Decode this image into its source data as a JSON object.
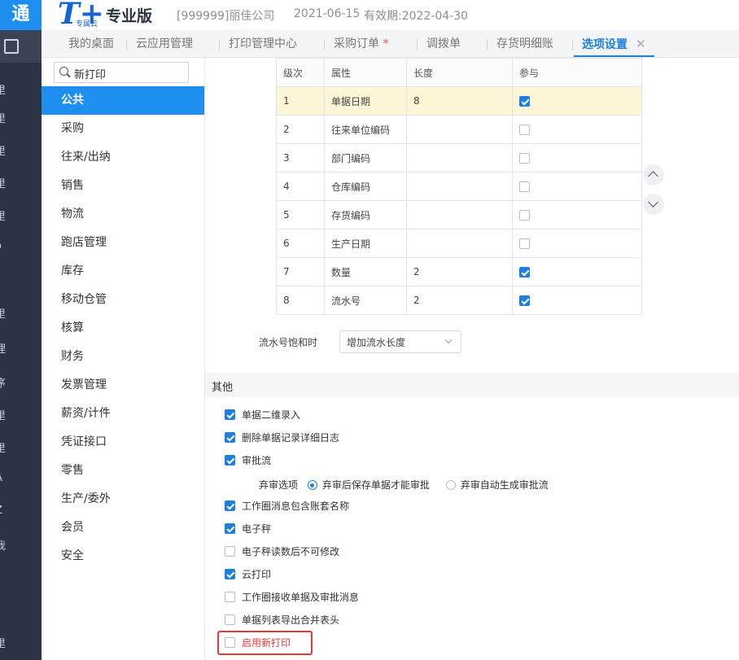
{
  "app": {
    "rail_title": "通",
    "logo_sub": "专属云",
    "edition": "专业版",
    "company": "[999999]丽佳公司",
    "date": "2021-06-15",
    "expire": "有效期:2022-04-30"
  },
  "rail_chars": [
    "里",
    "里",
    "里",
    "里",
    "里",
    "o",
    "里",
    "理",
    "序",
    "里",
    "里",
    "A",
    "Z",
    "我",
    "里"
  ],
  "tabs": [
    {
      "label": "我的桌面"
    },
    {
      "label": "云应用管理"
    },
    {
      "label": "打印管理中心"
    },
    {
      "label": "采购订单",
      "star": "*"
    },
    {
      "label": "调拨单"
    },
    {
      "label": "存货明细账"
    },
    {
      "label": "选项设置",
      "close": "✕"
    }
  ],
  "sidebar": {
    "search_value": "新打印",
    "items": [
      "公共",
      "采购",
      "往来/出纳",
      "销售",
      "物流",
      "跑店管理",
      "库存",
      "移动仓管",
      "核算",
      "财务",
      "发票管理",
      "薪资/计件",
      "凭证接口",
      "零售",
      "生产/委外",
      "会员",
      "安全"
    ]
  },
  "grid": {
    "headers": [
      "级次",
      "属性",
      "长度",
      "参与"
    ],
    "rows": [
      {
        "level": "1",
        "attr": "单据日期",
        "length": "8",
        "checked": true
      },
      {
        "level": "2",
        "attr": "往来单位编码",
        "length": "",
        "checked": false
      },
      {
        "level": "3",
        "attr": "部门编码",
        "length": "",
        "checked": false
      },
      {
        "level": "4",
        "attr": "仓库编码",
        "length": "",
        "checked": false
      },
      {
        "level": "5",
        "attr": "存货编码",
        "length": "",
        "checked": false
      },
      {
        "level": "6",
        "attr": "生产日期",
        "length": "",
        "checked": false
      },
      {
        "level": "7",
        "attr": "数量",
        "length": "2",
        "checked": true
      },
      {
        "level": "8",
        "attr": "流水号",
        "length": "2",
        "checked": true
      }
    ]
  },
  "serial": {
    "label": "流水号饱和时",
    "value": "增加流水长度"
  },
  "other": {
    "title": "其他",
    "options": [
      {
        "label": "单据二维录入",
        "checked": true
      },
      {
        "label": "删除单据记录详细日志",
        "checked": true
      },
      {
        "label": "审批流",
        "checked": true
      },
      {
        "label": "工作圈消息包含账套名称",
        "checked": true
      },
      {
        "label": "电子秤",
        "checked": true
      },
      {
        "label": "电子秤读数后不可修改",
        "checked": false
      },
      {
        "label": "云打印",
        "checked": true
      },
      {
        "label": "工作圈接收单据及审批消息",
        "checked": false
      },
      {
        "label": "单据列表导出合并表头",
        "checked": false
      },
      {
        "label": "启用新打印",
        "checked": false
      }
    ],
    "reject": {
      "label": "弃审选项",
      "opt1": "弃审后保存单据才能审批",
      "opt2": "弃审自动生成审批流"
    }
  },
  "colors": {
    "accent": "#1e8ef0",
    "highlight_row": "#fdf6d6",
    "focus_red": "#e53935"
  }
}
